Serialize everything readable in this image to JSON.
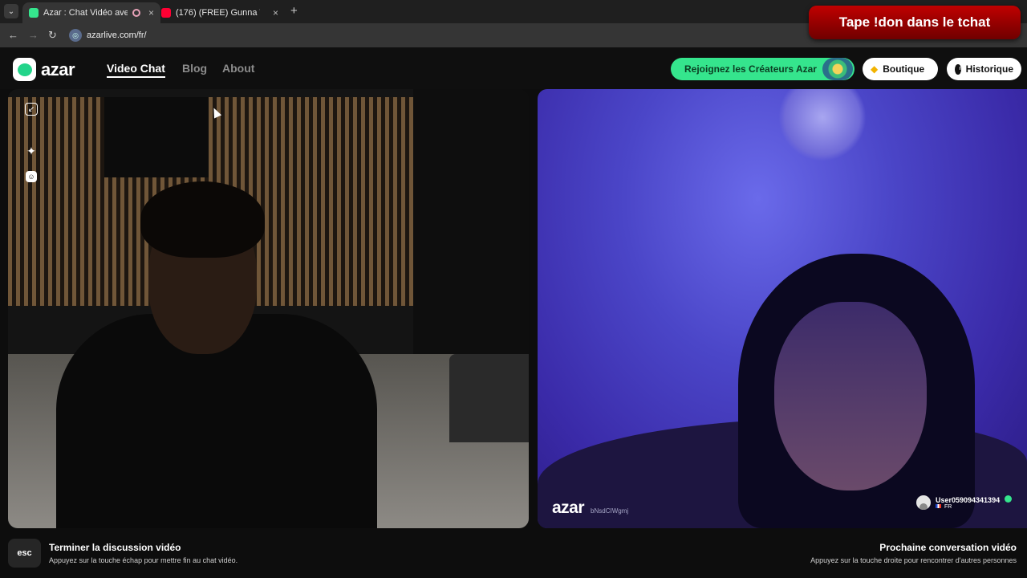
{
  "browser": {
    "tabs": [
      {
        "title": "Azar : Chat Vidéo avec de n",
        "favicon_color": "#35e58d",
        "active": true
      },
      {
        "title": "(176) (FREE) Gunna Type Beat -",
        "favicon_color": "#ff0033",
        "active": false
      }
    ],
    "url": "azarlive.com/fr/",
    "new_tab_glyph": "+",
    "close_glyph": "×"
  },
  "overlay": {
    "text": "Tape !don dans le tchat"
  },
  "header": {
    "logo_text": "azar",
    "nav": [
      {
        "label": "Video Chat",
        "active": true
      },
      {
        "label": "Blog",
        "active": false
      },
      {
        "label": "About",
        "active": false
      }
    ],
    "creators_label": "Rejoignez les Créateurs Azar",
    "shop_label": "Boutique",
    "history_label": "Historique"
  },
  "left_video": {
    "tools": [
      "minimize-icon",
      "sparkle-effects-icon",
      "sticker-face-icon"
    ]
  },
  "right_video": {
    "watermark_logo": "azar",
    "watermark_code": "bNsdCIWgmj",
    "peer": {
      "username": "User059094341394",
      "country": "FR"
    }
  },
  "footer": {
    "esc_key": "esc",
    "end_title": "Terminer la discussion vidéo",
    "end_sub": "Appuyez sur la touche échap pour mettre fin au chat vidéo.",
    "next_title": "Prochaine conversation vidéo",
    "next_sub": "Appuyez sur la touche droite pour rencontrer d'autres personnes"
  },
  "colors": {
    "accent": "#35e58d",
    "overlay_red": "#c00000"
  }
}
